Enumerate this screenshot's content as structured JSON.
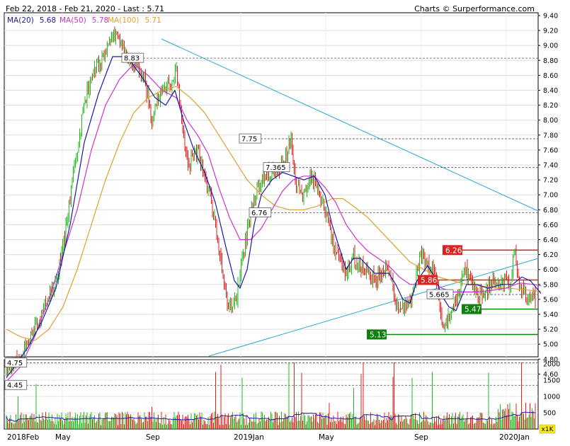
{
  "header": {
    "range": "Feb 22, 2018 - Feb 21, 2020 - Last : 5.71",
    "credit": "Charts © Surperformance.com"
  },
  "chart_data": {
    "type": "line",
    "subtype": "candlestick-with-volume",
    "y_ticks": [
      "9.40",
      "9.20",
      "9.00",
      "8.80",
      "8.60",
      "8.40",
      "8.20",
      "8.00",
      "7.80",
      "7.60",
      "7.40",
      "7.20",
      "7.00",
      "6.80",
      "6.60",
      "6.40",
      "6.20",
      "6.00",
      "5.80",
      "5.60",
      "5.40",
      "5.20",
      "5.00",
      "4.80",
      "4.60"
    ],
    "ylim": [
      4.4,
      9.45
    ],
    "x_labels": [
      "2018Feb",
      "May",
      "Sep",
      "2019Jan",
      "May",
      "Sep",
      "2020Jan"
    ],
    "volume_ticks": [
      "2000",
      "1500",
      "1000",
      "500"
    ],
    "volume_unit": "x1K",
    "legend": [
      {
        "label": "MA(20)",
        "value": "5.68",
        "color": "#1a1aa6"
      },
      {
        "label": "MA(50)",
        "value": "5.78",
        "color": "#cc33cc"
      },
      {
        "label": "MA(100)",
        "value": "5.71",
        "color": "#e0a030"
      }
    ],
    "level_labels": [
      {
        "text": "8.83",
        "value": 8.83
      },
      {
        "text": "7.75",
        "value": 7.75
      },
      {
        "text": "7.365",
        "value": 7.365
      },
      {
        "text": "6.76",
        "value": 6.76
      },
      {
        "text": "5.665",
        "value": 5.665
      },
      {
        "text": "4.75",
        "value": 4.75
      },
      {
        "text": "4.45",
        "value": 4.45
      }
    ],
    "resistance_labels": [
      {
        "text": "6.26",
        "value": 6.26
      },
      {
        "text": "5.86",
        "value": 5.86
      }
    ],
    "support_labels": [
      {
        "text": "5.47",
        "value": 5.47
      },
      {
        "text": "5.13",
        "value": 5.13
      }
    ],
    "price_series": [
      [
        0,
        4.62
      ],
      [
        15,
        4.75
      ],
      [
        30,
        5.0
      ],
      [
        45,
        5.3
      ],
      [
        55,
        5.55
      ],
      [
        70,
        5.85
      ],
      [
        82,
        6.4
      ],
      [
        95,
        7.3
      ],
      [
        105,
        7.9
      ],
      [
        115,
        8.45
      ],
      [
        125,
        8.7
      ],
      [
        135,
        8.8
      ],
      [
        145,
        9.1
      ],
      [
        155,
        9.15
      ],
      [
        165,
        8.95
      ],
      [
        175,
        8.82
      ],
      [
        185,
        8.7
      ],
      [
        195,
        8.55
      ],
      [
        205,
        8.0
      ],
      [
        215,
        8.35
      ],
      [
        230,
        8.45
      ],
      [
        240,
        8.7
      ],
      [
        248,
        7.9
      ],
      [
        258,
        7.4
      ],
      [
        270,
        7.6
      ],
      [
        280,
        7.2
      ],
      [
        290,
        6.9
      ],
      [
        298,
        6.4
      ],
      [
        305,
        5.95
      ],
      [
        312,
        5.55
      ],
      [
        318,
        5.45
      ],
      [
        325,
        5.65
      ],
      [
        335,
        6.2
      ],
      [
        345,
        6.8
      ],
      [
        355,
        7.1
      ],
      [
        365,
        7.25
      ],
      [
        375,
        7.3
      ],
      [
        385,
        7.3
      ],
      [
        395,
        7.55
      ],
      [
        402,
        7.7
      ],
      [
        410,
        7.1
      ],
      [
        420,
        7.0
      ],
      [
        430,
        7.25
      ],
      [
        440,
        7.1
      ],
      [
        450,
        6.8
      ],
      [
        460,
        6.4
      ],
      [
        470,
        6.2
      ],
      [
        480,
        5.95
      ],
      [
        490,
        6.15
      ],
      [
        500,
        6.05
      ],
      [
        510,
        5.95
      ],
      [
        520,
        5.85
      ],
      [
        530,
        5.95
      ],
      [
        540,
        6.05
      ],
      [
        548,
        5.6
      ],
      [
        555,
        5.45
      ],
      [
        565,
        5.55
      ],
      [
        575,
        5.7
      ],
      [
        585,
        6.2
      ],
      [
        595,
        6.05
      ],
      [
        605,
        6.0
      ],
      [
        612,
        5.55
      ],
      [
        617,
        5.15
      ],
      [
        625,
        5.45
      ],
      [
        635,
        5.5
      ],
      [
        645,
        6.0
      ],
      [
        655,
        5.9
      ],
      [
        665,
        5.65
      ],
      [
        675,
        5.6
      ],
      [
        685,
        5.85
      ],
      [
        695,
        5.8
      ],
      [
        705,
        5.85
      ],
      [
        712,
        5.75
      ],
      [
        718,
        6.3
      ],
      [
        725,
        5.7
      ],
      [
        735,
        5.65
      ],
      [
        745,
        5.6
      ],
      [
        755,
        5.71
      ]
    ],
    "ma20": [
      [
        0,
        4.55
      ],
      [
        15,
        4.75
      ],
      [
        30,
        4.95
      ],
      [
        50,
        5.3
      ],
      [
        70,
        5.75
      ],
      [
        90,
        6.6
      ],
      [
        110,
        7.7
      ],
      [
        130,
        8.35
      ],
      [
        150,
        8.85
      ],
      [
        170,
        8.85
      ],
      [
        190,
        8.6
      ],
      [
        210,
        8.3
      ],
      [
        225,
        8.2
      ],
      [
        238,
        8.4
      ],
      [
        250,
        8.0
      ],
      [
        265,
        7.6
      ],
      [
        280,
        7.3
      ],
      [
        295,
        6.9
      ],
      [
        310,
        6.3
      ],
      [
        322,
        5.85
      ],
      [
        330,
        5.75
      ],
      [
        340,
        6.0
      ],
      [
        350,
        6.6
      ],
      [
        360,
        7.0
      ],
      [
        375,
        7.2
      ],
      [
        390,
        7.3
      ],
      [
        405,
        7.25
      ],
      [
        420,
        7.2
      ],
      [
        435,
        7.25
      ],
      [
        450,
        7.0
      ],
      [
        460,
        6.6
      ],
      [
        470,
        6.3
      ],
      [
        480,
        6.0
      ],
      [
        490,
        6.15
      ],
      [
        500,
        6.15
      ],
      [
        510,
        6.05
      ],
      [
        520,
        5.95
      ],
      [
        530,
        5.95
      ],
      [
        540,
        5.95
      ],
      [
        550,
        5.8
      ],
      [
        560,
        5.6
      ],
      [
        570,
        5.55
      ],
      [
        580,
        5.85
      ],
      [
        595,
        6.05
      ],
      [
        605,
        5.9
      ],
      [
        615,
        5.65
      ],
      [
        625,
        5.5
      ],
      [
        635,
        5.45
      ],
      [
        650,
        5.8
      ],
      [
        665,
        5.8
      ],
      [
        680,
        5.75
      ],
      [
        700,
        5.8
      ],
      [
        715,
        5.8
      ],
      [
        728,
        5.9
      ],
      [
        740,
        5.85
      ],
      [
        755,
        5.68
      ]
    ],
    "ma50": [
      [
        0,
        4.5
      ],
      [
        20,
        4.7
      ],
      [
        40,
        5.1
      ],
      [
        60,
        5.6
      ],
      [
        80,
        6.2
      ],
      [
        100,
        6.8
      ],
      [
        120,
        7.6
      ],
      [
        140,
        8.2
      ],
      [
        160,
        8.55
      ],
      [
        180,
        8.75
      ],
      [
        200,
        8.6
      ],
      [
        220,
        8.4
      ],
      [
        240,
        8.3
      ],
      [
        255,
        8.0
      ],
      [
        270,
        7.8
      ],
      [
        285,
        7.55
      ],
      [
        300,
        7.1
      ],
      [
        315,
        6.7
      ],
      [
        330,
        6.4
      ],
      [
        345,
        6.4
      ],
      [
        360,
        6.55
      ],
      [
        375,
        6.8
      ],
      [
        390,
        7.05
      ],
      [
        405,
        7.2
      ],
      [
        420,
        7.25
      ],
      [
        435,
        7.25
      ],
      [
        450,
        7.1
      ],
      [
        465,
        6.9
      ],
      [
        480,
        6.6
      ],
      [
        495,
        6.4
      ],
      [
        510,
        6.25
      ],
      [
        525,
        6.15
      ],
      [
        540,
        6.05
      ],
      [
        555,
        5.9
      ],
      [
        570,
        5.8
      ],
      [
        585,
        5.8
      ],
      [
        600,
        5.85
      ],
      [
        615,
        5.75
      ],
      [
        630,
        5.7
      ],
      [
        645,
        5.7
      ],
      [
        665,
        5.7
      ],
      [
        685,
        5.72
      ],
      [
        705,
        5.75
      ],
      [
        725,
        5.82
      ],
      [
        745,
        5.8
      ],
      [
        755,
        5.78
      ]
    ],
    "ma100": [
      [
        0,
        5.2
      ],
      [
        20,
        5.1
      ],
      [
        40,
        5.05
      ],
      [
        60,
        5.2
      ],
      [
        80,
        5.5
      ],
      [
        100,
        6.0
      ],
      [
        120,
        6.6
      ],
      [
        140,
        7.2
      ],
      [
        160,
        7.7
      ],
      [
        180,
        8.1
      ],
      [
        200,
        8.3
      ],
      [
        220,
        8.4
      ],
      [
        240,
        8.45
      ],
      [
        260,
        8.3
      ],
      [
        280,
        8.1
      ],
      [
        300,
        7.8
      ],
      [
        320,
        7.5
      ],
      [
        340,
        7.2
      ],
      [
        360,
        7.0
      ],
      [
        380,
        6.85
      ],
      [
        400,
        6.8
      ],
      [
        420,
        6.8
      ],
      [
        440,
        6.85
      ],
      [
        460,
        6.95
      ],
      [
        475,
        6.95
      ],
      [
        490,
        6.85
      ],
      [
        510,
        6.7
      ],
      [
        530,
        6.5
      ],
      [
        550,
        6.3
      ],
      [
        570,
        6.1
      ],
      [
        590,
        6.0
      ],
      [
        610,
        5.9
      ],
      [
        630,
        5.85
      ],
      [
        650,
        5.8
      ],
      [
        670,
        5.78
      ],
      [
        690,
        5.75
      ],
      [
        710,
        5.75
      ],
      [
        730,
        5.73
      ],
      [
        755,
        5.71
      ]
    ]
  }
}
